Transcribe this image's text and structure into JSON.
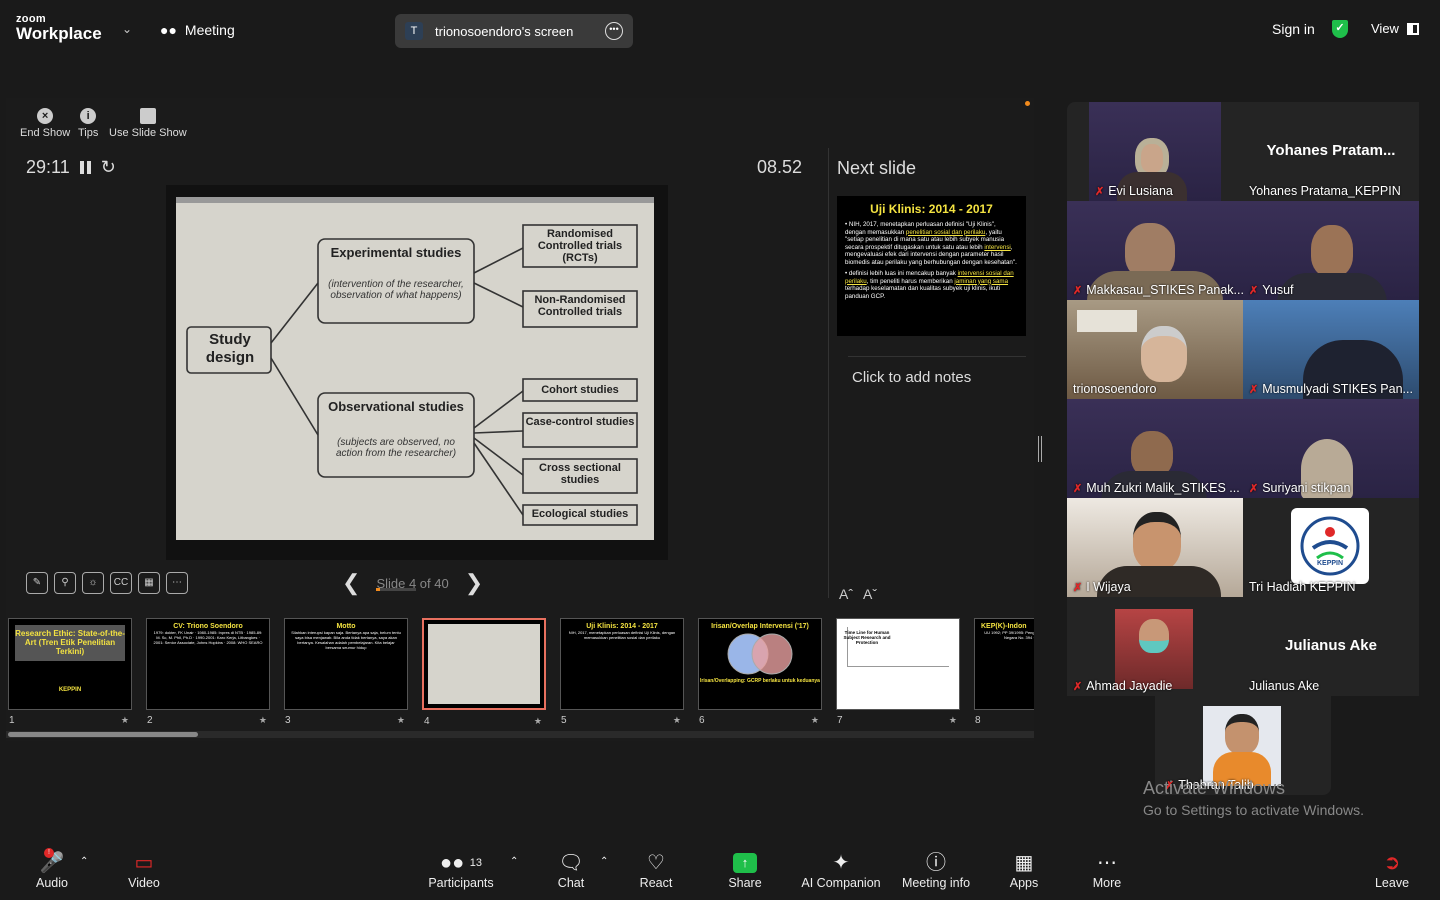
{
  "app": {
    "logo_line1": "zoom",
    "logo_line2": "Workplace",
    "meeting_label": "Meeting"
  },
  "screen_share": {
    "avatar_letter": "T",
    "title": "trionosoendoro's screen"
  },
  "top_right": {
    "signin": "Sign in",
    "view": "View"
  },
  "presenter": {
    "tools": [
      {
        "label": "End Show",
        "icon": "close-icon"
      },
      {
        "label": "Tips",
        "icon": "info-icon"
      },
      {
        "label": "Use Slide Show",
        "icon": "slides-icon"
      }
    ],
    "timer": "29:11",
    "clock": "08.52",
    "next_slide_label": "Next slide",
    "notes_placeholder": "Click to add notes",
    "slide_counter": "Slide 4 of 40",
    "slide_progress": 0.1,
    "current_slide": {
      "root": "Study design",
      "exp_title": "Experimental studies",
      "exp_sub": "(intervention of the researcher, observation of what happens)",
      "obs_title": "Observational studies",
      "obs_sub": "(subjects are observed, no action from the researcher)",
      "exp_leaves": [
        "Randomised Controlled trials (RCTs)",
        "Non-Randomised Controlled trials"
      ],
      "obs_leaves": [
        "Cohort studies",
        "Case-control studies",
        "Cross sectional studies",
        "Ecological studies"
      ]
    },
    "next_slide": {
      "title": "Uji Klinis: 2014 - 2017",
      "bullet1_a": "NIH, 2017, menetapkan perluasan definisi \"Uji Klinis\", dengan memasukkan ",
      "bullet1_hl1": "penelitian sosial dan perilaku",
      "bullet1_b": ", yaitu \"setiap penelitian di mana satu atau lebih subyek manusia secara prospektif ditugaskan untuk satu atau lebih ",
      "bullet1_hl2": "intervensi",
      "bullet1_c": ", mengevaluasi efek dari intervensi dengan parameter hasil biomedis atau perilaku yang berhubungan dengan kesehatan\".",
      "bullet2_a": "definisi lebih luas ini mencakup banyak ",
      "bullet2_hl1": "intervensi sosial dan perilaku",
      "bullet2_b": ", tim peneliti harus memberikan ",
      "bullet2_hl2": "jaminan yang sama",
      "bullet2_c": " terhadap keselamatan dan kualitas subyek uji klinis, ikuti panduan GCP."
    },
    "thumbnails": [
      {
        "num": "1",
        "title": "Research Ethic: State-of-the-Art (Tren Etik Penelitian Terkini)",
        "body": "KEPPIN"
      },
      {
        "num": "2",
        "title": "CV: Triono Soendoro",
        "body": "1979: dokter, FK Unair · 1980-1985: Inpres di NTB · 1985-89: M. Sc, M. Phil, Ph.D · 1990-2001: Karo Kerja, Litbangkes · 2001: Senior Associate, Johns Hopkins · 2008: WHO SEARO"
      },
      {
        "num": "3",
        "title": "Motto",
        "body": "Silahkan interupsi kapan saja. Bertanya apa saja, belum tentu saya bisa menjawab. Bila anda tidak bertanya, saya akan bertanya. Kesalahan adalah pembelajaran. Kita belajar bersama seumur hidup"
      },
      {
        "num": "4",
        "title": "",
        "body": ""
      },
      {
        "num": "5",
        "title": "Uji Klinis: 2014 - 2017",
        "body": "NIH, 2017, menetapkan perluasan definisi Uji Klinis, dengan memasukkan penelitian sosial dan perilaku"
      },
      {
        "num": "6",
        "title": "Irisan/Overlap Intervensi ('17)",
        "body": "Irisan/Overlapping: GCRP berlaku untuk keduanya"
      },
      {
        "num": "7",
        "title": "Time Line for Human Subject Research and Protection",
        "body": ""
      },
      {
        "num": "8",
        "title": "KEP(K)-Indon",
        "body": "UU 1992; PP 39/1995: Pengembangan Kesehatan · Berita Negara No. 394 · Pemenkes 7/2016"
      }
    ]
  },
  "participants": [
    {
      "name": "Evi Lusiana",
      "muted": true,
      "video": true
    },
    {
      "name": "Yohanes Pratama_KEPPIN",
      "big_name": "Yohanes  Pratam...",
      "muted": false,
      "video": false
    },
    {
      "name": "Makkasau_STIKES Panak...",
      "muted": true,
      "video": true
    },
    {
      "name": "Yusuf",
      "muted": true,
      "video": true
    },
    {
      "name": "trionosoendoro",
      "muted": false,
      "video": true,
      "speaking": true
    },
    {
      "name": "Musmulyadi STIKES Pan...",
      "muted": true,
      "video": true
    },
    {
      "name": "Muh Zukri Malik_STIKES ...",
      "muted": true,
      "video": true
    },
    {
      "name": "Suriyani stikpan",
      "muted": true,
      "video": true
    },
    {
      "name": "I Wijaya",
      "muted": true,
      "video": true
    },
    {
      "name": "Tri Hadiah KEPPIN",
      "muted": false,
      "video": false,
      "logo": "KEPPIN"
    },
    {
      "name": "Ahmad Jayadie",
      "muted": true,
      "video": true
    },
    {
      "name": "Julianus Ake",
      "big_name": "Julianus Ake",
      "muted": false,
      "video": false
    },
    {
      "name": "Thabran Talib",
      "muted": true,
      "video": false
    }
  ],
  "watermark": {
    "line1": "Activate Windows",
    "line2": "Go to Settings to activate Windows."
  },
  "toolbar": {
    "audio": "Audio",
    "video": "Video",
    "participants": "Participants",
    "participants_count": "13",
    "chat": "Chat",
    "react": "React",
    "share": "Share",
    "ai": "AI Companion",
    "info": "Meeting info",
    "apps": "Apps",
    "more": "More",
    "leave": "Leave"
  },
  "colors": {
    "accent_green": "#1fbf4a",
    "speaking": "#21c85a",
    "mute_red": "#e02828",
    "slide_yellow": "#f4e341",
    "progress_orange": "#f28b1d"
  }
}
